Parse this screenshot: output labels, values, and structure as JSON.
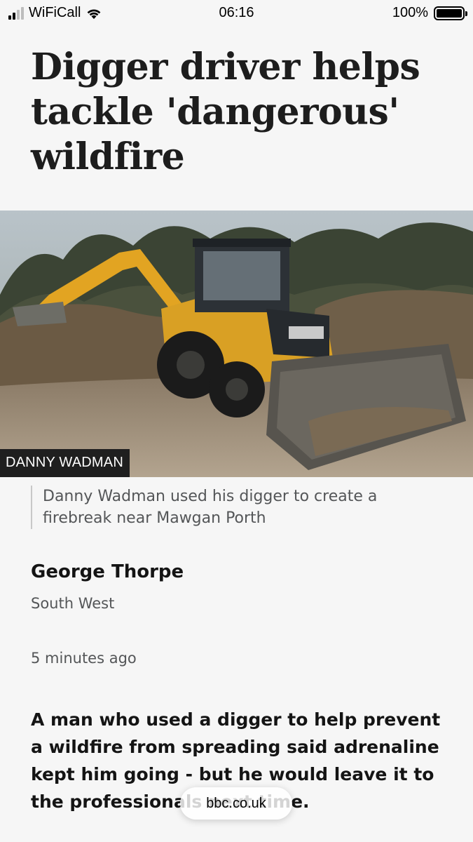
{
  "status_bar": {
    "carrier": "WiFiCall",
    "time": "06:16",
    "battery_percent": "100%",
    "battery_level": 1.0
  },
  "article": {
    "headline": "Digger driver helps tackle 'dangerous' wildfire",
    "image_credit": "DANNY WADMAN",
    "caption": "Danny Wadman used his digger to create a firebreak near Mawgan Porth",
    "author": "George Thorpe",
    "region": "South West",
    "timestamp": "5 minutes ago",
    "intro": "A man who used a digger to help prevent a wildfire from spreading said adrenaline kept him going - but he would leave it to the professionals next time."
  },
  "browser": {
    "url": "bbc.co.uk"
  }
}
